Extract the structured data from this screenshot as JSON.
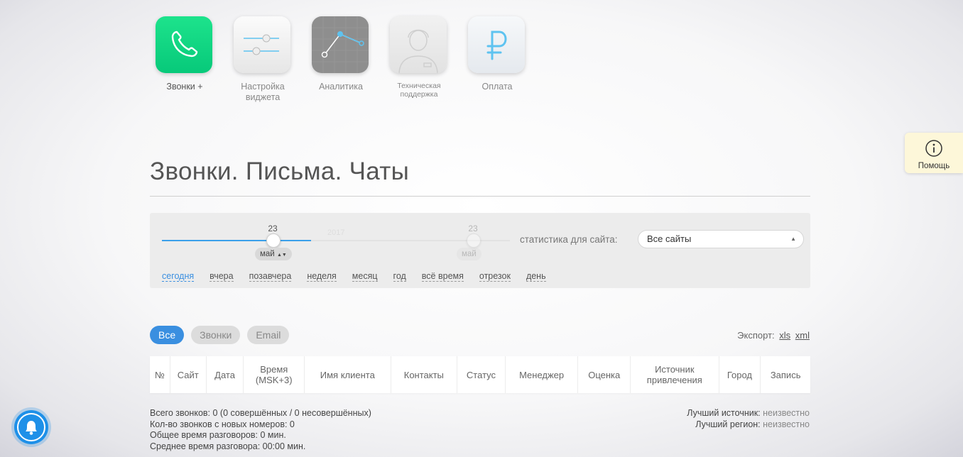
{
  "nav": [
    {
      "label": "Звонки +",
      "icon": "phone-icon"
    },
    {
      "label": "Настройка виджета",
      "icon": "sliders-icon"
    },
    {
      "label": "Аналитика",
      "icon": "chart-icon"
    },
    {
      "label": "Техническая поддержка",
      "icon": "operator-icon"
    },
    {
      "label": "Оплата",
      "icon": "ruble-icon"
    }
  ],
  "help": {
    "label": "Помощь",
    "icon": "info-icon"
  },
  "page": {
    "title": "Звонки. Письма. Чаты"
  },
  "filter": {
    "slider_day": "23",
    "slider_month": "май",
    "ghost_day": "23",
    "ghost_month": "май",
    "ghost_year": "2017",
    "stat_label": "статистика для сайта:",
    "site_select": "Все сайты",
    "periods": [
      "сегодня",
      "вчера",
      "позавчера",
      "неделя",
      "месяц",
      "год",
      "всё время",
      "отрезок",
      "день"
    ]
  },
  "tabs": [
    "Все",
    "Звонки",
    "Email"
  ],
  "export": {
    "label": "Экспорт:",
    "xls": "xls",
    "xml": "xml"
  },
  "table": {
    "headers": [
      "№",
      "Сайт",
      "Дата",
      "Время (MSK+3)",
      "Имя клиента",
      "Контакты",
      "Статус",
      "Менеджер",
      "Оценка",
      "Источник привлечения",
      "Город",
      "Запись"
    ]
  },
  "summary": {
    "total": "Всего звонков: 0 (0 совершённых / 0 несовершённых)",
    "new_numbers": "Кол-во звонков с новых номеров: 0",
    "total_time": "Общее время разговоров: 0 мин.",
    "avg_time": "Среднее время разговора: 00:00 мин.",
    "best_source_label": "Лучший источник:",
    "best_source_value": "неизвестно",
    "best_region_label": "Лучший регион:",
    "best_region_value": "неизвестно"
  },
  "colors": {
    "accent": "#3a8fe0",
    "calls_green": "#07c97a",
    "help_bg": "#fdf7d9",
    "bell": "#1e90e8"
  }
}
